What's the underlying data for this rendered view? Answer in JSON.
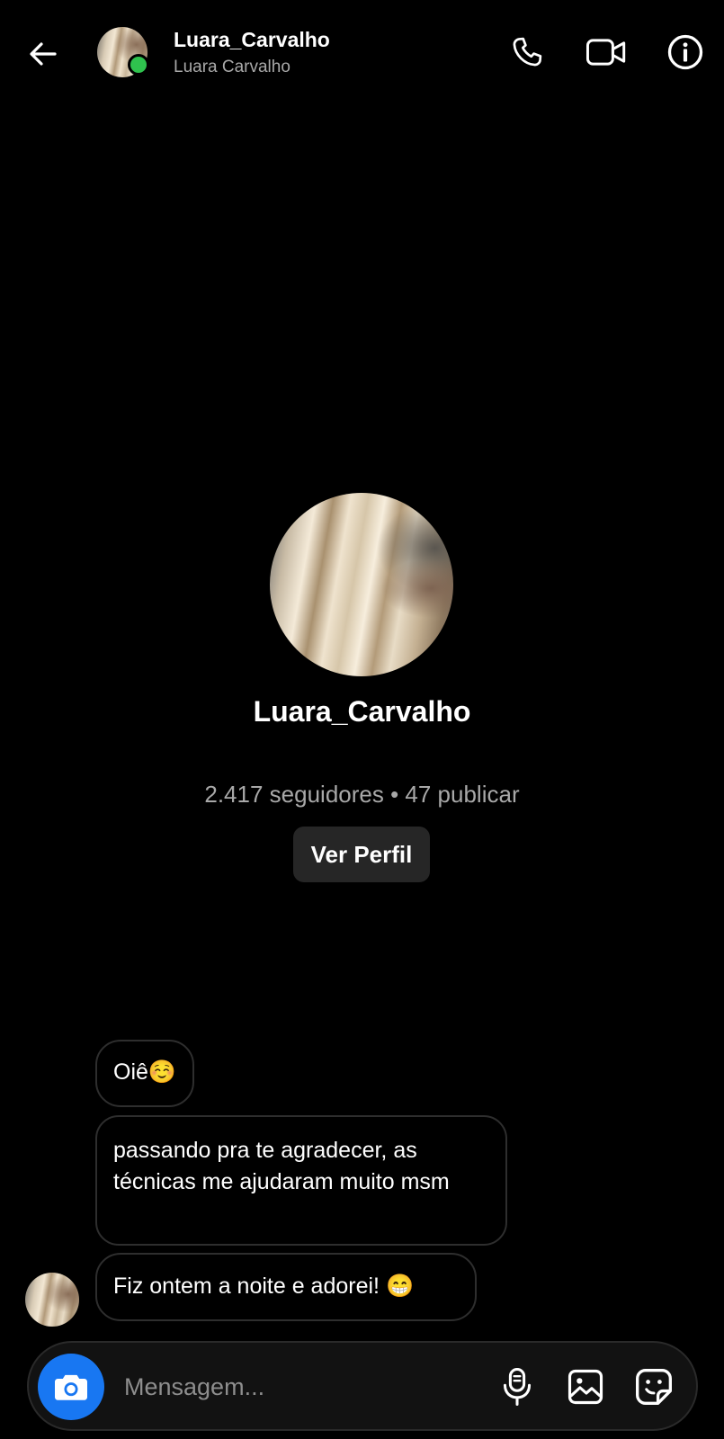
{
  "header": {
    "username": "Luara_Carvalho",
    "full_name": "Luara Carvalho",
    "online": true,
    "icons": [
      "back-arrow-icon",
      "phone-icon",
      "video-camera-icon",
      "info-icon"
    ]
  },
  "profile": {
    "username": "Luara_Carvalho",
    "stats": "2.417 seguidores • 47 publicar",
    "view_profile_label": "Ver Perfil"
  },
  "messages": [
    {
      "text": "Oiê☺️",
      "sender": "Luara_Carvalho"
    },
    {
      "text": "passando pra te agradecer, as técnicas me ajudaram muito msm",
      "sender": "Luara_Carvalho"
    },
    {
      "text": "Fiz ontem a noite e adorei! 😁",
      "sender": "Luara_Carvalho"
    }
  ],
  "composer": {
    "placeholder": "Mensagem...",
    "icons": [
      "camera-icon",
      "microphone-icon",
      "gallery-icon",
      "sticker-icon"
    ]
  },
  "colors": {
    "background": "#000000",
    "accent": "#1877f2",
    "online": "#2fc24e",
    "secondary_text": "#a8a8a8",
    "button_bg": "#262626"
  }
}
